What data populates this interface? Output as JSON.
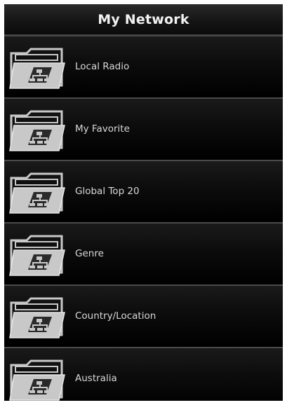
{
  "header": {
    "title": "My Network"
  },
  "list": {
    "items": [
      {
        "label": "Local Radio",
        "icon": "network-folder-icon"
      },
      {
        "label": "My Favorite",
        "icon": "network-folder-icon"
      },
      {
        "label": "Global Top 20",
        "icon": "network-folder-icon"
      },
      {
        "label": "Genre",
        "icon": "network-folder-icon"
      },
      {
        "label": "Country/Location",
        "icon": "network-folder-icon"
      },
      {
        "label": "Australia",
        "icon": "network-folder-icon"
      }
    ]
  },
  "colors": {
    "background": "#0a0a0a",
    "title_text": "#f2f2f2",
    "item_text": "#d8d8d8",
    "folder_fill": "#c8c8c8"
  }
}
